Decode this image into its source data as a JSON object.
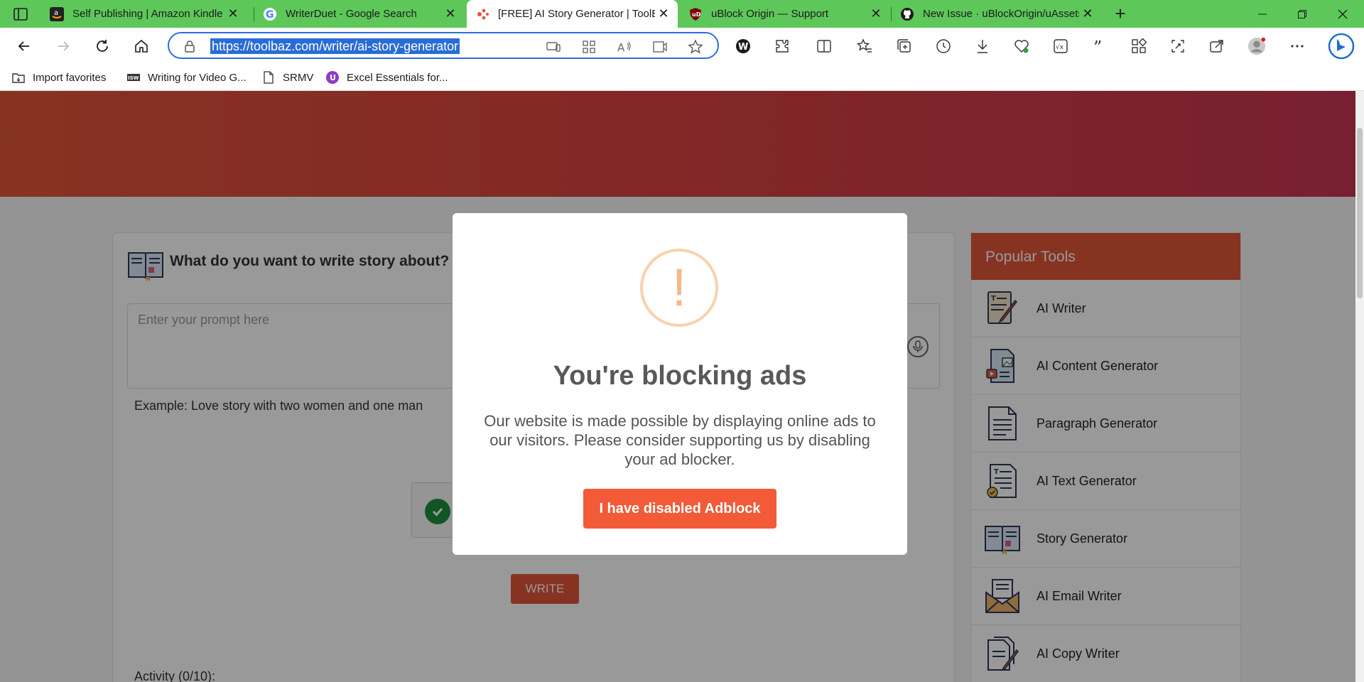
{
  "browser": {
    "tabs": [
      {
        "title": "Self Publishing | Amazon Kindle D",
        "favicon": "amazon-icon",
        "active": false
      },
      {
        "title": "WriterDuet - Google Search",
        "favicon": "google-icon",
        "active": false
      },
      {
        "title": "[FREE] AI Story Generator | ToolBaz",
        "favicon": "toolbaz-icon",
        "active": true
      },
      {
        "title": "uBlock Origin — Support",
        "favicon": "ublock-icon",
        "active": false
      },
      {
        "title": "New Issue · uBlockOrigin/uAssets",
        "favicon": "github-icon",
        "active": false
      }
    ],
    "url": "https://toolbaz.com/writer/ai-story-generator",
    "favorites": [
      {
        "label": "Import favorites",
        "icon": "import-favorites-icon"
      },
      {
        "label": "Writing for Video G...",
        "icon": "site-favicon"
      },
      {
        "label": "SRMV",
        "icon": "page-icon"
      },
      {
        "label": "Excel Essentials for...",
        "icon": "course-icon"
      }
    ],
    "theme_color": "#5ec75a"
  },
  "page": {
    "card_title": "What do you want to write story about?",
    "prompt_placeholder": "Enter your prompt here",
    "example": "Example: Love story with two women and one man",
    "write_button": "WRITE",
    "activity_label": "Activity (0/10):",
    "accent_color": "#e2553a",
    "sidebar": {
      "title": "Popular Tools",
      "items": [
        {
          "label": "AI Writer",
          "icon": "ai-writer-icon"
        },
        {
          "label": "AI Content Generator",
          "icon": "content-generator-icon"
        },
        {
          "label": "Paragraph Generator",
          "icon": "paragraph-icon"
        },
        {
          "label": "AI Text Generator",
          "icon": "text-generator-icon"
        },
        {
          "label": "Story Generator",
          "icon": "book-icon"
        },
        {
          "label": "AI Email Writer",
          "icon": "email-icon"
        },
        {
          "label": "AI Copy Writer",
          "icon": "copy-writer-icon"
        }
      ]
    }
  },
  "modal": {
    "icon": "exclamation-icon",
    "title": "You're blocking ads",
    "text": "Our website is made possible by displaying online ads to our visitors. Please consider supporting us by disabling your ad blocker.",
    "button": "I have disabled Adblock"
  }
}
